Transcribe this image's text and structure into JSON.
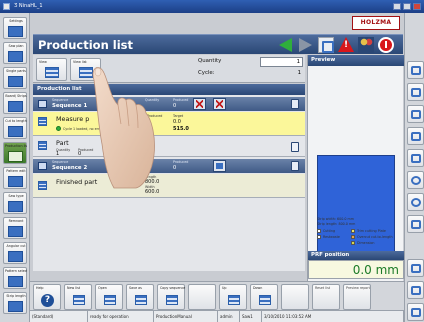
{
  "window": {
    "title": "Ʒ NinaHL_1"
  },
  "logo": {
    "text": "HOLZMA"
  },
  "header": {
    "title": "Production list"
  },
  "left_toolbar": [
    {
      "label": "Settings"
    },
    {
      "label": "Saw plan"
    },
    {
      "label": "Single parts"
    },
    {
      "label": "Board/ Strips"
    },
    {
      "label": "Cut to length"
    },
    {
      "label": "Production list"
    },
    {
      "label": "Pattern edit"
    },
    {
      "label": "Saw type"
    },
    {
      "label": "Remnant"
    },
    {
      "label": "Angular cut"
    },
    {
      "label": "Pattern selection"
    },
    {
      "label": "Strip length"
    }
  ],
  "controls": {
    "view_button_1": "View",
    "view_button_2": "View list",
    "quantity_label": "Quantity",
    "quantity_value": "1",
    "cycle_label": "Cycle:",
    "cycle_value": "1"
  },
  "list": {
    "title": "Production list",
    "sequence_1": {
      "caption": "Sequence",
      "name": "Sequence 1",
      "cap2": "Quantity",
      "cap3": "Produced",
      "val3": "0"
    },
    "measure_row": {
      "name": "Measure p",
      "status": "Cycle 1 loaded, no errors",
      "len_caption": "Length",
      "len_value": "—",
      "prod_caption": "Produced",
      "prod_value": "0",
      "target_caption": "Target",
      "target_value": "0.0",
      "pos_value": "515.0"
    },
    "part_row": {
      "name": "Part",
      "qty_caption": "Quantity",
      "qty_value": "1",
      "prod_caption": "Produced",
      "prod_value": "0"
    },
    "sequence_2": {
      "caption": "Sequence",
      "name": "Sequence 2",
      "cap3": "Produced",
      "val3": "0"
    },
    "finished_row": {
      "name": "Finished part",
      "len_caption": "Length",
      "len_value": "800.0",
      "width_caption": "Width",
      "width_value": "600.0"
    }
  },
  "preview": {
    "title": "Preview",
    "info_1": "Strip width: 600.0 mm",
    "info_2": "Strip length: 800.0 mm",
    "legend": [
      {
        "label": "Cutting",
        "color": "#ffffff"
      },
      {
        "label": "Trim cutting Plate",
        "color": "#e9e36c"
      },
      {
        "label": "Restwaste",
        "color": "#ffffff"
      },
      {
        "label": "Overcut cut-to-length",
        "color": "#e9a445"
      },
      {
        "label": "",
        "color": "#ffffff"
      },
      {
        "label": "Dimension",
        "color": "#d8d84a"
      }
    ],
    "prf_title": "PRF position",
    "prf_value": "0.0 mm"
  },
  "bottom_toolbar": [
    {
      "label": "Help"
    },
    {
      "label": "New list"
    },
    {
      "label": "Open"
    },
    {
      "label": "Save as"
    },
    {
      "label": "Copy sequence"
    },
    {
      "label": ""
    },
    {
      "label": "Up"
    },
    {
      "label": "Down"
    },
    {
      "label": ""
    },
    {
      "label": "Reset list"
    },
    {
      "label": "Preview report"
    }
  ],
  "status_bar": {
    "panel_1": "(Standard)",
    "panel_2": "ready for operation",
    "panel_3": "ProductionManual",
    "panel_4": "admin",
    "panel_5": "Saw1",
    "panel_6": "3/10/2010 11:03:52 AM"
  },
  "accent_colors": {
    "title_blue": "#2a4775",
    "active_green": "#3d7b2c",
    "selected_row": "#fbf79a",
    "prf_value_green": "#1b7b27"
  }
}
